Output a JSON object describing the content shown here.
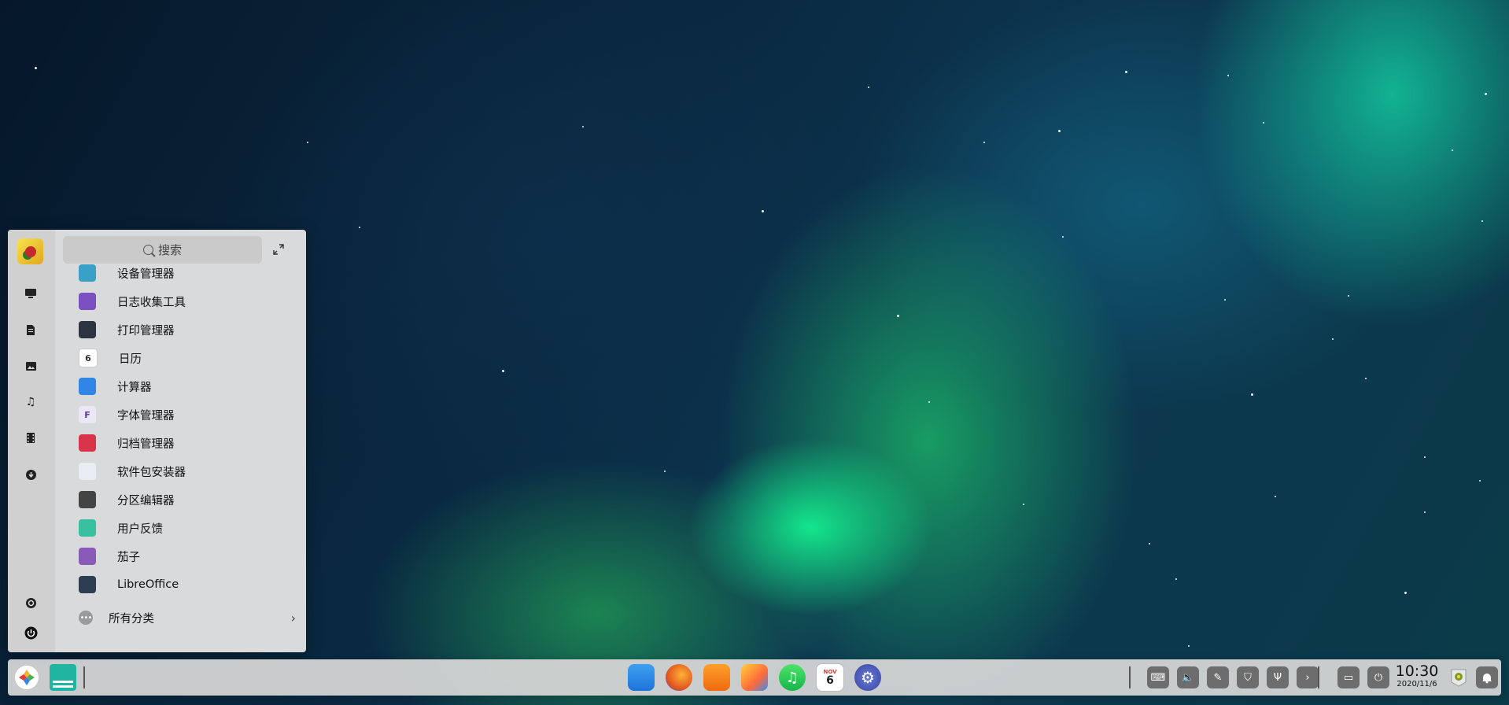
{
  "launcher": {
    "search_placeholder": "搜索",
    "apps": [
      {
        "label": "设备管理器",
        "icon": "device-manager-icon",
        "color": "#3aa0c8"
      },
      {
        "label": "日志收集工具",
        "icon": "log-collector-icon",
        "color": "#7a4fbf"
      },
      {
        "label": "打印管理器",
        "icon": "printer-icon",
        "color": "#2b3440"
      },
      {
        "label": "日历",
        "icon": "calendar-icon",
        "color": "#ffffff"
      },
      {
        "label": "计算器",
        "icon": "calculator-icon",
        "color": "#2f86e6"
      },
      {
        "label": "字体管理器",
        "icon": "font-manager-icon",
        "color": "#ece7f6"
      },
      {
        "label": "归档管理器",
        "icon": "archive-manager-icon",
        "color": "#d9354a"
      },
      {
        "label": "软件包安装器",
        "icon": "package-installer-icon",
        "color": "#e8eef4"
      },
      {
        "label": "分区编辑器",
        "icon": "partition-editor-icon",
        "color": "#444444"
      },
      {
        "label": "用户反馈",
        "icon": "feedback-icon",
        "color": "#38c0a0"
      },
      {
        "label": "茄子",
        "icon": "cheese-icon",
        "color": "#8a5ab8"
      },
      {
        "label": "LibreOffice",
        "icon": "libreoffice-icon",
        "color": "#2c3e50"
      }
    ],
    "all_categories": "所有分类",
    "sidebar": [
      "computer-icon",
      "documents-icon",
      "pictures-icon",
      "music-icon",
      "videos-icon",
      "downloads-icon",
      "settings-icon",
      "power-icon"
    ]
  },
  "taskbar": {
    "dock_apps": [
      "file-manager-icon",
      "firefox-icon",
      "app-store-icon",
      "image-viewer-icon",
      "music-player-icon",
      "calendar-dock-icon",
      "control-center-icon"
    ],
    "calendar_day": "6",
    "calendar_month": "NOV",
    "tray": [
      "keyboard-icon",
      "volume-icon",
      "pen-icon",
      "shield-icon",
      "usb-icon",
      "chevron-right-icon",
      "display-icon",
      "power-tray-icon"
    ],
    "time": "10:30",
    "date": "2020/11/6"
  }
}
